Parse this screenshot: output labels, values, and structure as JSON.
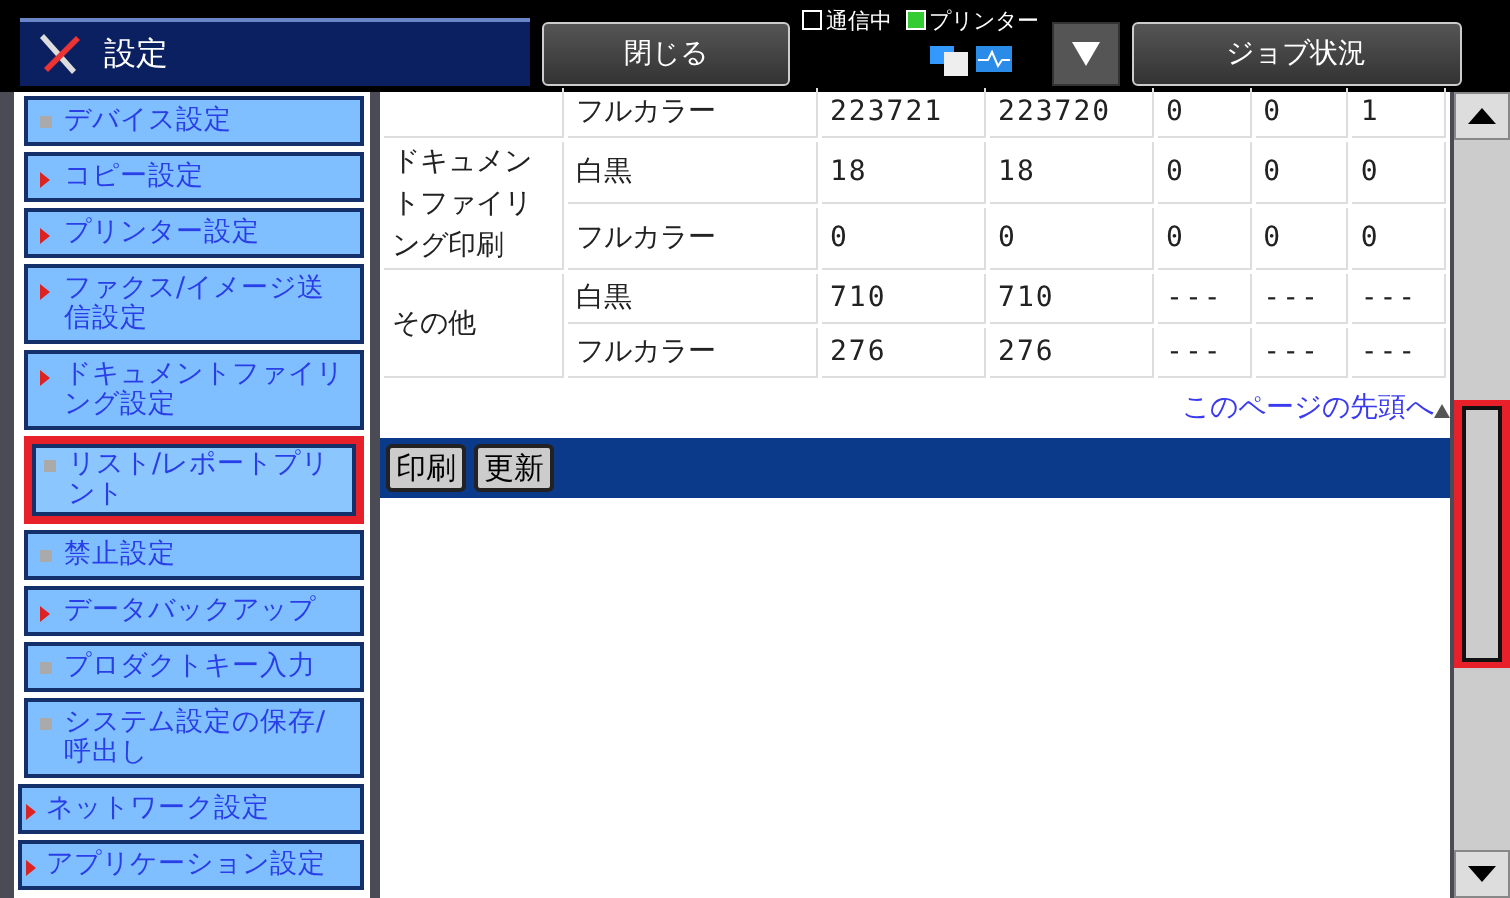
{
  "header": {
    "title": "設定",
    "close_button": "閉じる",
    "indicators": [
      {
        "label": "通信中",
        "kind": "checkbox",
        "checked": false
      },
      {
        "label": "プリンター",
        "kind": "led",
        "checked": true
      }
    ],
    "job_status_button": "ジョブ状況"
  },
  "sidebar": {
    "items": [
      {
        "label": "デバイス設定",
        "kind": "leaf",
        "highlighted": false
      },
      {
        "label": "コピー設定",
        "kind": "branch",
        "highlighted": false
      },
      {
        "label": "プリンター設定",
        "kind": "branch",
        "highlighted": false
      },
      {
        "label": "ファクス/イメージ送信設定",
        "kind": "branch",
        "highlighted": false
      },
      {
        "label": "ドキュメントファイリング設定",
        "kind": "branch",
        "highlighted": false
      },
      {
        "label": "リスト/レポートプリント",
        "kind": "leaf",
        "highlighted": true
      },
      {
        "label": "禁止設定",
        "kind": "leaf",
        "highlighted": false
      },
      {
        "label": "データバックアップ",
        "kind": "branch",
        "highlighted": false
      },
      {
        "label": "プロダクトキー入力",
        "kind": "leaf",
        "highlighted": false
      },
      {
        "label": "システム設定の保存/呼出し",
        "kind": "leaf",
        "highlighted": false
      },
      {
        "label": "ネットワーク設定",
        "kind": "section",
        "highlighted": false
      },
      {
        "label": "アプリケーション設定",
        "kind": "section",
        "highlighted": false
      }
    ]
  },
  "table": {
    "groups": [
      {
        "rows": [
          [
            "フルカラー",
            "223721",
            "223720",
            "0",
            "0",
            "1"
          ]
        ]
      },
      {
        "label": "ドキュメントファイリング印刷",
        "rows": [
          [
            "白黒",
            "18",
            "18",
            "0",
            "0",
            "0"
          ],
          [
            "フルカラー",
            "0",
            "0",
            "0",
            "0",
            "0"
          ]
        ]
      },
      {
        "label": "その他",
        "rows": [
          [
            "白黒",
            "710",
            "710",
            "---",
            "---",
            "---"
          ],
          [
            "フルカラー",
            "276",
            "276",
            "---",
            "---",
            "---"
          ]
        ]
      }
    ]
  },
  "page_top_link": "このページの先頭へ",
  "actions": [
    "印刷",
    "更新"
  ],
  "scrollbar": {
    "highlighted": true
  }
}
